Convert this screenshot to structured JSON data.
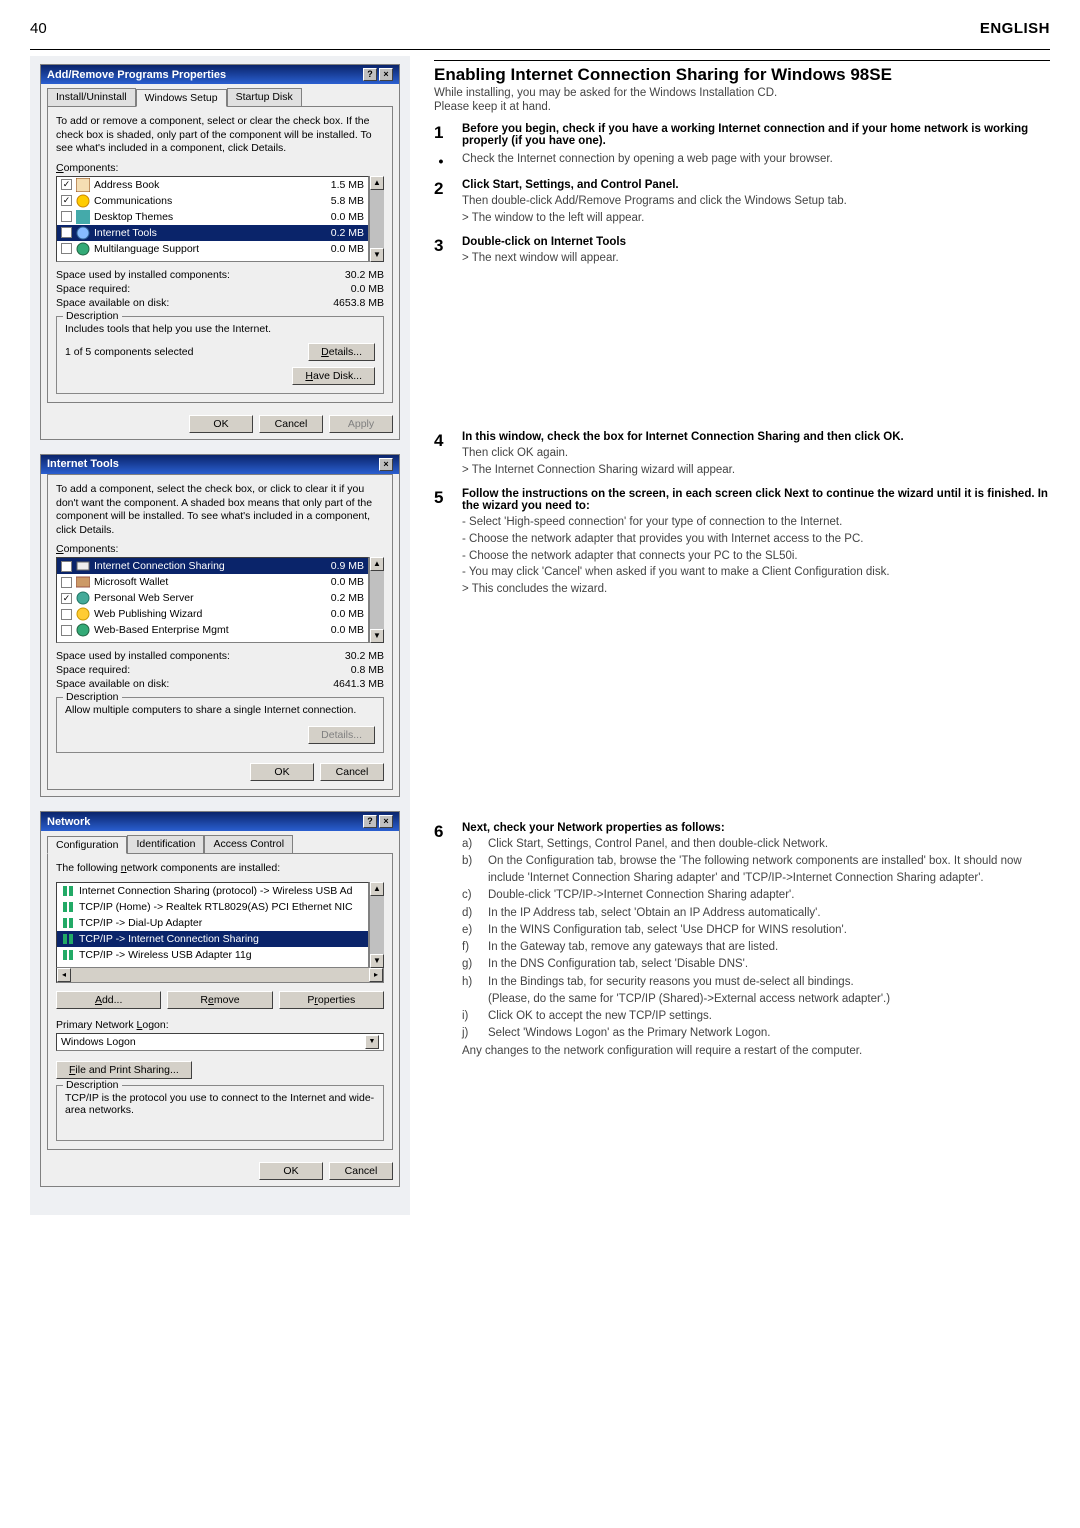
{
  "page": {
    "number": "40",
    "language": "ENGLISH"
  },
  "win1": {
    "title": "Add/Remove Programs Properties",
    "tabs": [
      "Install/Uninstall",
      "Windows Setup",
      "Startup Disk"
    ],
    "instr": "To add or remove a component, select or clear the check box. If the check box is shaded, only part of the component will be installed. To see what's included in a component, click Details.",
    "comp_label": "Components:",
    "items": [
      {
        "checked": true,
        "label": "Address Book",
        "size": "1.5 MB"
      },
      {
        "checked": true,
        "label": "Communications",
        "size": "5.8 MB"
      },
      {
        "checked": false,
        "label": "Desktop Themes",
        "size": "0.0 MB"
      },
      {
        "checked": true,
        "label": "Internet Tools",
        "size": "0.2 MB",
        "selected": true
      },
      {
        "checked": false,
        "label": "Multilanguage Support",
        "size": "0.0 MB"
      }
    ],
    "space_used_lbl": "Space used by installed components:",
    "space_used": "30.2 MB",
    "space_req_lbl": "Space required:",
    "space_req": "0.0 MB",
    "space_avail_lbl": "Space available on disk:",
    "space_avail": "4653.8 MB",
    "desc_title": "Description",
    "desc": "Includes tools that help you use the Internet.",
    "selcount": "1 of 5 components selected",
    "btn_details": "Details...",
    "btn_havedisk": "Have Disk...",
    "btn_ok": "OK",
    "btn_cancel": "Cancel",
    "btn_apply": "Apply"
  },
  "win2": {
    "title": "Internet Tools",
    "instr": "To add a component, select the check box, or click to clear it if you don't want the component. A shaded box means that only part of the component will be installed. To see what's included in a component, click Details.",
    "comp_label": "Components:",
    "items": [
      {
        "checked": true,
        "label": "Internet Connection Sharing",
        "size": "0.9 MB",
        "selected": true
      },
      {
        "checked": false,
        "label": "Microsoft Wallet",
        "size": "0.0 MB"
      },
      {
        "checked": true,
        "label": "Personal Web Server",
        "size": "0.2 MB"
      },
      {
        "checked": false,
        "label": "Web Publishing Wizard",
        "size": "0.0 MB"
      },
      {
        "checked": false,
        "label": "Web-Based Enterprise Mgmt",
        "size": "0.0 MB"
      }
    ],
    "space_used_lbl": "Space used by installed components:",
    "space_used": "30.2 MB",
    "space_req_lbl": "Space required:",
    "space_req": "0.8 MB",
    "space_avail_lbl": "Space available on disk:",
    "space_avail": "4641.3 MB",
    "desc_title": "Description",
    "desc": "Allow multiple computers to share a single Internet connection.",
    "btn_details": "Details...",
    "btn_ok": "OK",
    "btn_cancel": "Cancel"
  },
  "win3": {
    "title": "Network",
    "tabs": [
      "Configuration",
      "Identification",
      "Access Control"
    ],
    "installed_lbl": "The following network components are installed:",
    "items": [
      "Internet Connection Sharing (protocol) -> Wireless USB Ad",
      "TCP/IP (Home) -> Realtek RTL8029(AS) PCI Ethernet NIC",
      "TCP/IP -> Dial-Up Adapter",
      "TCP/IP -> Internet Connection Sharing",
      "TCP/IP -> Wireless USB Adapter 11g"
    ],
    "btn_add": "Add...",
    "btn_remove": "Remove",
    "btn_props": "Properties",
    "logon_lbl": "Primary Network Logon:",
    "logon_val": "Windows Logon",
    "btn_fileshare": "File and Print Sharing...",
    "desc_title": "Description",
    "desc": "TCP/IP is the protocol you use to connect to the Internet and wide-area networks.",
    "btn_ok": "OK",
    "btn_cancel": "Cancel"
  },
  "article": {
    "title": "Enabling Internet Connection Sharing for Windows 98SE",
    "sub1": "While installing, you may be asked for the Windows Installation CD.",
    "sub2": "Please keep it at hand.",
    "s1_b": "Before you begin, check if you have a working Internet connection and if your home network is working properly (if you have one).",
    "bul1": "Check the Internet connection by opening a web page with your browser.",
    "s2_b": "Click Start, Settings, and Control Panel.",
    "s2_t1": "Then double-click Add/Remove Programs and click the Windows Setup tab.",
    "s2_t2": "> The window to the left will appear.",
    "s3_b": "Double-click on Internet Tools",
    "s3_t1": "> The next window will appear.",
    "s4_b": "In this window, check the box for Internet Connection Sharing and then click OK.",
    "s4_t1": "Then click OK again.",
    "s4_t2": "> The Internet Connection Sharing wizard will appear.",
    "s5_b": "Follow the instructions on the screen, in each screen click Next to continue the wizard until it is finished. In the wizard you need to:",
    "s5_i1": "- Select 'High-speed connection' for your type of connection to the Internet.",
    "s5_i2": "- Choose the network adapter that provides you with Internet access to the PC.",
    "s5_i3": "- Choose the network adapter that connects your PC to the SL50i.",
    "s5_i4": "- You may click 'Cancel' when asked if you want to make a Client Configuration disk.",
    "s5_i5": "> This concludes the wizard.",
    "s6_b": "Next, check your Network properties as follows:",
    "s6": {
      "a": "Click Start, Settings, Control Panel, and then double-click Network.",
      "b": "On the Configuration tab, browse the 'The following network components are installed' box. It should now include 'Internet Connection Sharing adapter' and 'TCP/IP->Internet Connection Sharing adapter'.",
      "c": "Double-click 'TCP/IP->Internet Connection Sharing adapter'.",
      "d": "In the IP Address tab, select 'Obtain an IP Address automatically'.",
      "e": "In the WINS Configuration tab, select 'Use DHCP for WINS resolution'.",
      "f": "In the Gateway tab, remove any gateways that are listed.",
      "g": "In the DNS Configuration tab, select 'Disable DNS'.",
      "h": "In the Bindings tab, for security reasons you must de-select all bindings.",
      "h2": "(Please, do the same for 'TCP/IP (Shared)->External access network adapter'.)",
      "i": "Click OK to accept the new TCP/IP settings.",
      "j": "Select 'Windows Logon' as the Primary Network Logon."
    },
    "s6_end": "Any changes to the network configuration will require a restart of the computer."
  }
}
